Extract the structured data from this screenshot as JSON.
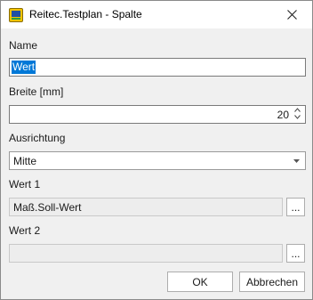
{
  "window": {
    "title": "Reitec.Testplan - Spalte"
  },
  "form": {
    "name_label": "Name",
    "name_value": "Wert",
    "breite_label": "Breite [mm]",
    "breite_value": "20",
    "ausrichtung_label": "Ausrichtung",
    "ausrichtung_value": "Mitte",
    "wert1_label": "Wert 1",
    "wert1_value": "Maß.Soll-Wert",
    "wert2_label": "Wert 2",
    "wert2_value": "",
    "browse_label": "..."
  },
  "buttons": {
    "ok": "OK",
    "cancel": "Abbrechen"
  },
  "icons": {
    "app": "app-icon",
    "close": "close-icon",
    "spin_up": "chevron-up-icon",
    "spin_down": "chevron-down-icon",
    "dropdown": "caret-down-icon"
  },
  "colors": {
    "selection": "#0078d7",
    "dialog_bg": "#f0f0f0"
  }
}
